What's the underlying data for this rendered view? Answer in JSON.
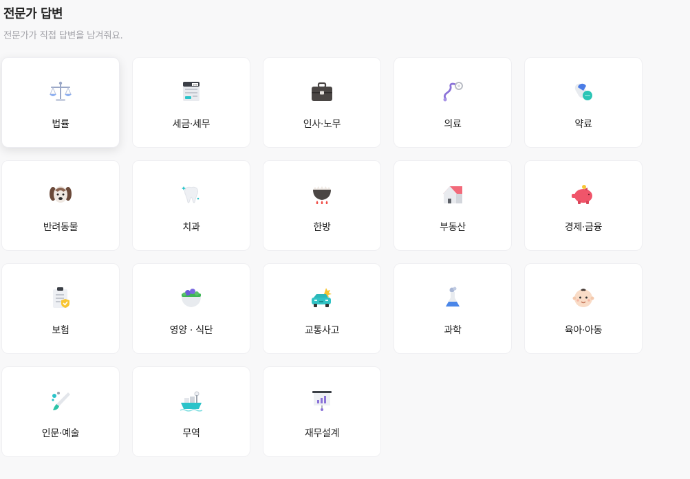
{
  "header": {
    "title": "전문가 답변",
    "subtitle": "전문가가 직접 답변을 남겨줘요."
  },
  "categories": [
    {
      "label": "법률",
      "icon": "scales-icon"
    },
    {
      "label": "세금·세무",
      "icon": "tax-calculator-icon"
    },
    {
      "label": "인사·노무",
      "icon": "briefcase-icon"
    },
    {
      "label": "의료",
      "icon": "stethoscope-icon"
    },
    {
      "label": "약료",
      "icon": "pill-icon"
    },
    {
      "label": "반려동물",
      "icon": "dog-icon"
    },
    {
      "label": "치과",
      "icon": "tooth-icon"
    },
    {
      "label": "한방",
      "icon": "herbal-pot-icon"
    },
    {
      "label": "부동산",
      "icon": "house-icon"
    },
    {
      "label": "경제·금융",
      "icon": "piggy-bank-icon"
    },
    {
      "label": "보험",
      "icon": "insurance-clipboard-icon"
    },
    {
      "label": "영양 · 식단",
      "icon": "salad-bowl-icon"
    },
    {
      "label": "교통사고",
      "icon": "car-crash-icon"
    },
    {
      "label": "과학",
      "icon": "flask-icon"
    },
    {
      "label": "육아·아동",
      "icon": "baby-face-icon"
    },
    {
      "label": "인문·예술",
      "icon": "paintbrush-icon"
    },
    {
      "label": "무역",
      "icon": "cargo-ship-icon"
    },
    {
      "label": "재무설계",
      "icon": "financial-chart-icon"
    }
  ]
}
